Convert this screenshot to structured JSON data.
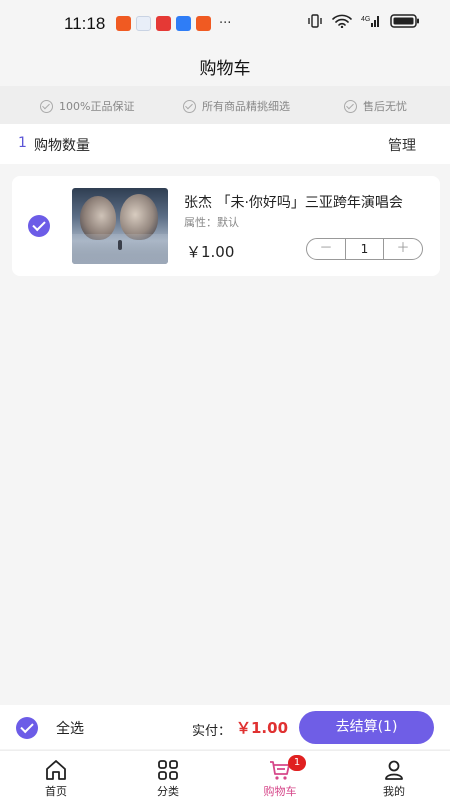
{
  "status_bar": {
    "time": "11:18",
    "notification_icons": [
      {
        "name": "app-notification-icon",
        "color": "#f05a22"
      },
      {
        "name": "app-notification-icon",
        "color": "#e8eef8"
      },
      {
        "name": "app-notification-icon",
        "color": "#e53935"
      },
      {
        "name": "app-notification-icon",
        "color": "#2f7df6"
      },
      {
        "name": "app-notification-icon",
        "color": "#f05a22"
      }
    ],
    "more": "···"
  },
  "header": {
    "title": "购物车"
  },
  "guarantees": [
    "100%正品保证",
    "所有商品精挑细选",
    "售后无忧"
  ],
  "cart_summary": {
    "count": "1",
    "label": "购物数量",
    "manage": "管理"
  },
  "cart_items": [
    {
      "title": "张杰 「未·你好吗」三亚跨年演唱会",
      "attribute": "属性：默认",
      "price": "￥1.00",
      "quantity": "1",
      "decrement": "－",
      "increment": "＋",
      "checked": true
    }
  ],
  "checkout": {
    "select_all": "全选",
    "paid_label": "实付：",
    "amount": "￥1.00",
    "button": "去结算(1)"
  },
  "tabbar": {
    "items": [
      {
        "label": "首页",
        "icon": "home-icon"
      },
      {
        "label": "分类",
        "icon": "grid-icon"
      },
      {
        "label": "购物车",
        "icon": "cart-icon",
        "badge": "1",
        "active": true
      },
      {
        "label": "我的",
        "icon": "user-icon"
      }
    ]
  },
  "colors": {
    "accent": "#6c5ce7",
    "price_red": "#e03131",
    "active_tab": "#d6478a"
  }
}
